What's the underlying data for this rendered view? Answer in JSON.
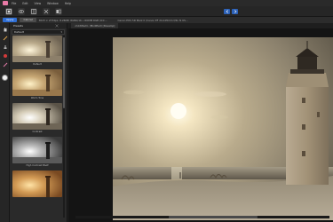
{
  "menu": {
    "items": [
      "File",
      "Edit",
      "View",
      "Window",
      "Help"
    ]
  },
  "context": {
    "apply_label": "Apply",
    "cancel_label": "Cancel",
    "info1": "3023 × 2734px, 8.26MP, RGBA/16 • ROMM RGB (ICC...",
    "info2": "Canon EOS 5D Mark II (Canon EF 24-105mm f/4L IS US..."
  },
  "panel": {
    "tab_label": "Presets",
    "select_value": "Default",
    "presets": [
      {
        "label": "Default"
      },
      {
        "label": "Warm Tone"
      },
      {
        "label": "Contrast"
      },
      {
        "label": "High Contrast B&W"
      },
      {
        "label": ""
      }
    ]
  },
  "document": {
    "tab_label": "<Untitled> (Modified) [Develop]"
  },
  "colors": {
    "accent": "#2f6fd6",
    "brand": "#e87aa6"
  }
}
